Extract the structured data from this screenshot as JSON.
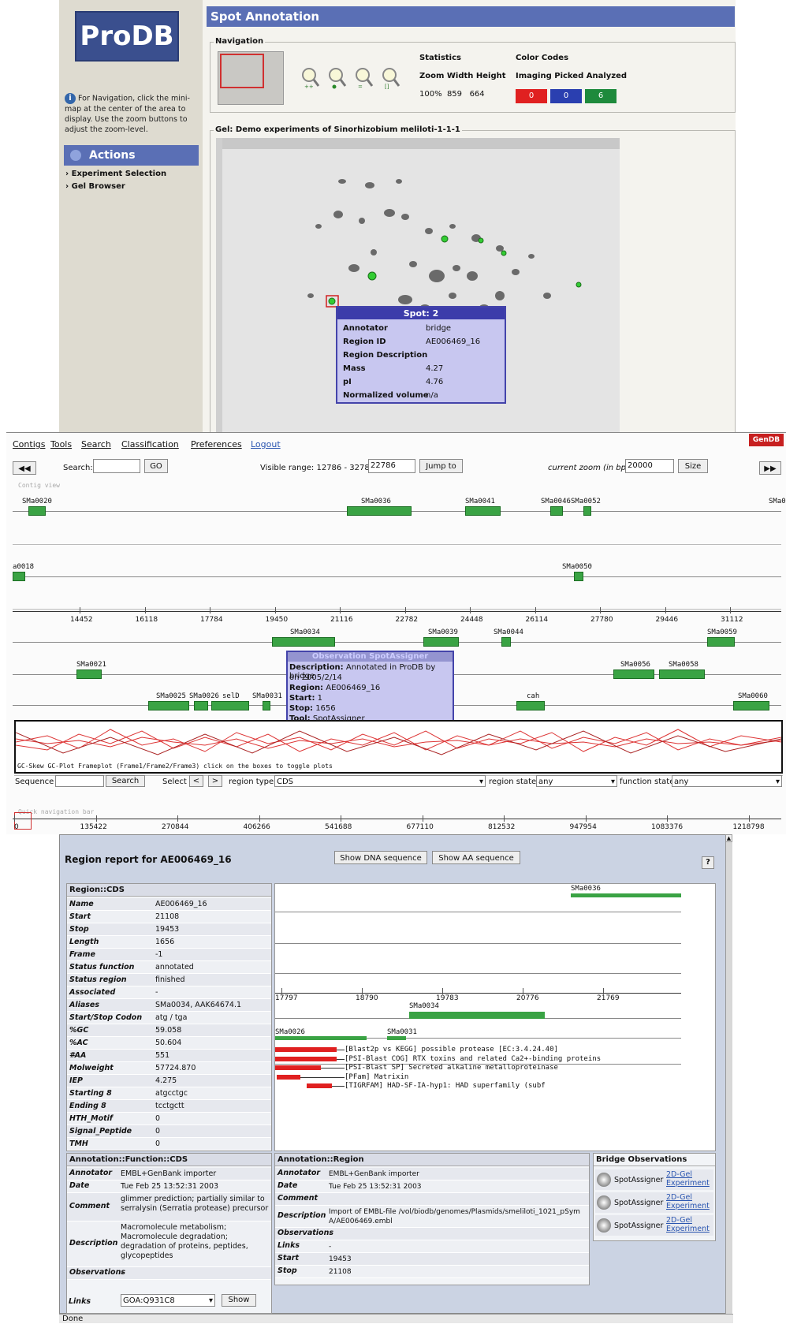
{
  "spot": {
    "logo": "ProDB",
    "title": "Spot Annotation",
    "navigation_label": "Navigation",
    "nav_help": "For Navigation, click the mini-map at the center of the area to display. Use the zoom buttons to adjust the zoom-level.",
    "actions_label": "Actions",
    "actions": [
      "Experiment Selection",
      "Gel Browser"
    ],
    "stats_label": "Statistics",
    "stats_headers": "Zoom Width Height",
    "stats_values": "100%  859   664",
    "color_codes_label": "Color Codes",
    "color_codes_headers": "Imaging Picked Analyzed",
    "color_codes": [
      {
        "value": "0",
        "color": "#e02020"
      },
      {
        "value": "0",
        "color": "#2a3fb0"
      },
      {
        "value": "6",
        "color": "#1e8a3c"
      }
    ],
    "gel_label": "Gel: Demo experiments of Sinorhizobium meliloti-1-1-1",
    "tooltip": {
      "title": "Spot: 2",
      "rows": [
        {
          "k": "Annotator",
          "v": "bridge"
        },
        {
          "k": "Region ID",
          "v": "AE006469_16"
        },
        {
          "k": "Region Description",
          "v": ""
        },
        {
          "k": "Mass",
          "v": "4.27"
        },
        {
          "k": "pI",
          "v": "4.76"
        },
        {
          "k": "Normalized volume",
          "v": "n/a"
        }
      ]
    }
  },
  "contig": {
    "menu": [
      "Contigs",
      "Tools",
      "Search",
      "Classification",
      "Preferences",
      "Logout"
    ],
    "brand": "GenDB",
    "search_label": "Search:",
    "go_label": "GO",
    "visible_range": "Visible range: 12786 - 32786",
    "range_start": "22786",
    "jump_label": "Jump to",
    "zoom_label": "current zoom (in bp):",
    "zoom_value": "20000",
    "size_label": "Size",
    "contig_view_label": "Contig view",
    "ruler_ticks": [
      "14452",
      "16118",
      "17784",
      "19450",
      "21116",
      "22782",
      "24448",
      "26114",
      "27780",
      "29446",
      "31112"
    ],
    "genes_row1": [
      "SMa0020",
      "SMa0036",
      "SMa0041",
      "SMa0046",
      "SMa0052",
      "SMa0"
    ],
    "genes_row2": [
      "a0018",
      "SMa0050"
    ],
    "genes_row3": [
      "SMa0034",
      "SMa0039",
      "SMa0044",
      "SMa0059"
    ],
    "genes_row4": [
      "SMa0021",
      "SMa0056",
      "SMa0058"
    ],
    "genes_row5": [
      "SMa0025",
      "SMa0026",
      "selD",
      "SMa0031",
      "cah",
      "SMa0060"
    ],
    "tooltip": {
      "title": "Observation SpotAssigner",
      "lines": [
        {
          "k": "Description:",
          "v": " Annotated in ProDB by bridge"
        },
        {
          "k": "",
          "v": "on 2005/2/14"
        },
        {
          "k": "Region:",
          "v": " AE006469_16"
        },
        {
          "k": "Start:",
          "v": " 1"
        },
        {
          "k": "Stop:",
          "v": " 1656"
        },
        {
          "k": "Tool:",
          "v": " SpotAssigner"
        }
      ]
    },
    "plot_legend": "GC-Skew  GC-Plot  Frameplot (Frame1/Frame2/Frame3)  click on the boxes to toggle plots",
    "sequence_label": "Sequence",
    "search_btn": "Search",
    "select_label": "Select",
    "prev": "<",
    "next": ">",
    "region_type_label": "region type",
    "region_type": "CDS",
    "region_state_label": "region state",
    "region_state": "any",
    "function_state_label": "function state",
    "function_state": "any",
    "quicknav_label": "Quick navigation bar",
    "quicknav_ticks": [
      "0",
      "135422",
      "270844",
      "406266",
      "541688",
      "677110",
      "812532",
      "947954",
      "1083376",
      "1218798"
    ]
  },
  "region": {
    "title": "Region report for AE006469_16",
    "show_dna": "Show DNA sequence",
    "show_aa": "Show AA sequence",
    "help": "?",
    "cds_header": "Region::CDS",
    "cds": [
      {
        "k": "Name",
        "v": "AE006469_16"
      },
      {
        "k": "Start",
        "v": "21108"
      },
      {
        "k": "Stop",
        "v": "19453"
      },
      {
        "k": "Length",
        "v": "1656"
      },
      {
        "k": "Frame",
        "v": "-1"
      },
      {
        "k": "Status function",
        "v": "annotated"
      },
      {
        "k": "Status region",
        "v": "finished"
      },
      {
        "k": "Associated",
        "v": "-"
      },
      {
        "k": "Aliases",
        "v": "SMa0034, AAK64674.1"
      },
      {
        "k": "Start/Stop Codon",
        "v": "atg / tga"
      },
      {
        "k": "%GC",
        "v": "59.058"
      },
      {
        "k": "%AC",
        "v": "50.604"
      },
      {
        "k": "#AA",
        "v": "551"
      },
      {
        "k": "Molweight",
        "v": "57724.870"
      },
      {
        "k": "IEP",
        "v": "4.275"
      },
      {
        "k": "Starting 8",
        "v": "atgcctgc"
      },
      {
        "k": "Ending 8",
        "v": "tcctgctt"
      },
      {
        "k": "HTH_Motif",
        "v": "0"
      },
      {
        "k": "Signal_Peptide",
        "v": "0"
      },
      {
        "k": "TMH",
        "v": "0"
      }
    ],
    "mini_genes": [
      "SMa0036",
      "SMa0034",
      "SMa0026",
      "SMa0031"
    ],
    "mini_ticks": [
      "17797",
      "18790",
      "19783",
      "20776",
      "21769"
    ],
    "blast_hits": [
      "[Blast2p vs KEGG] possible protease [EC:3.4.24.40]",
      "[PSI-Blast COG] RTX toxins and related Ca2+-binding proteins",
      "[PSI-Blast SP] Secreted alkaline metalloproteinase",
      "[PFam] Matrixin",
      "[TIGRFAM] HAD-SF-IA-hyp1: HAD superfamily (subf"
    ],
    "func_header": "Annotation::Function::CDS",
    "func": [
      {
        "k": "Annotator",
        "v": "EMBL+GenBank importer"
      },
      {
        "k": "Date",
        "v": "Tue Feb 25 13:52:31 2003"
      },
      {
        "k": "Comment",
        "v": "glimmer prediction; partially similar to serralysin (Serratia protease) precursor"
      },
      {
        "k": "Description",
        "v": "Macromolecule metabolism; Macromolecule degradation; degradation of proteins, peptides, glycopeptides"
      },
      {
        "k": "Observations",
        "v": "-"
      }
    ],
    "links_label": "Links",
    "links_value": "GOA:Q931C8",
    "show_btn": "Show",
    "reg_header": "Annotation::Region",
    "reg": [
      {
        "k": "Annotator",
        "v": "EMBL+GenBank importer"
      },
      {
        "k": "Date",
        "v": "Tue Feb 25 13:52:31 2003"
      },
      {
        "k": "Comment",
        "v": ""
      },
      {
        "k": "Description",
        "v": "Import of EMBL-file /vol/biodb/genomes/Plasmids/smeliloti_1021_pSymA/AE006469.embl"
      },
      {
        "k": "Observations",
        "v": "-"
      },
      {
        "k": "Links",
        "v": "-"
      },
      {
        "k": "Start",
        "v": "19453"
      },
      {
        "k": "Stop",
        "v": "21108"
      }
    ],
    "bridge_header": "Bridge Observations",
    "bridge": [
      {
        "tool": "SpotAssigner",
        "link": "2D-Gel Experiment"
      },
      {
        "tool": "SpotAssigner",
        "link": "2D-Gel Experiment"
      },
      {
        "tool": "SpotAssigner",
        "link": "2D-Gel Experiment"
      }
    ],
    "status": "Done"
  }
}
